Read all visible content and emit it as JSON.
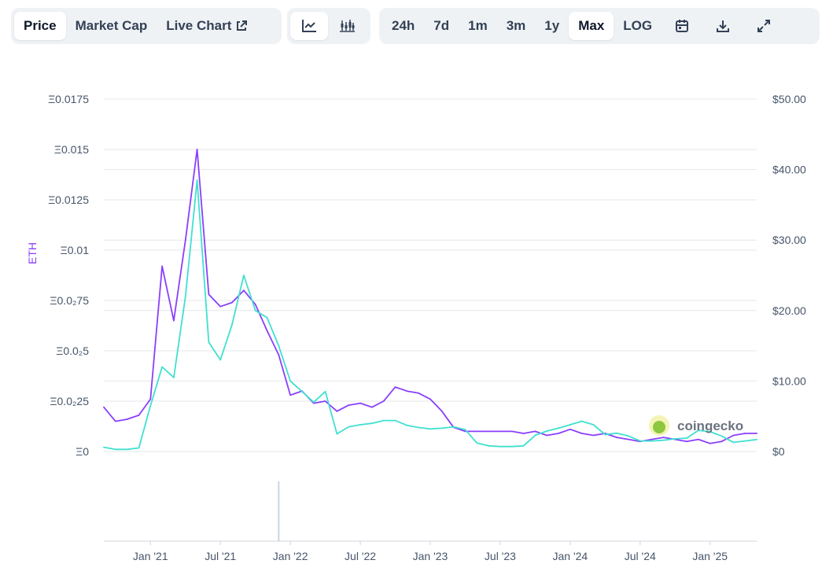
{
  "toolbar": {
    "metric_tabs": [
      "Price",
      "Market Cap",
      "Live Chart"
    ],
    "active_metric": "Price",
    "chart_type_icons": [
      "line-chart-icon",
      "candlestick-chart-icon"
    ],
    "ranges": [
      "24h",
      "7d",
      "1m",
      "3m",
      "1y",
      "Max",
      "LOG"
    ],
    "active_range": "Max",
    "action_icons": [
      "calendar-icon",
      "download-icon",
      "expand-icon"
    ]
  },
  "watermark": {
    "text": "coingecko"
  },
  "colors": {
    "eth_series": "#8a3ffc",
    "usd_series": "#40e0d0",
    "grid": "#e5e7eb",
    "axis_text": "#475569"
  },
  "chart_data": {
    "type": "line",
    "title": "",
    "y_left": {
      "label": "ETH",
      "ticks": [
        "Ξ0.0175",
        "Ξ0.015",
        "Ξ0.0125",
        "Ξ0.01",
        "Ξ0.0₂75",
        "Ξ0.0₂5",
        "Ξ0.0₂25",
        "Ξ0"
      ],
      "range": [
        0,
        0.0175
      ]
    },
    "y_right": {
      "ticks": [
        "$50.00",
        "$40.00",
        "$30.00",
        "$20.00",
        "$10.00",
        "$0"
      ],
      "range": [
        0,
        50
      ]
    },
    "x_ticks": [
      "Jan '21",
      "Jul '21",
      "Jan '22",
      "Jul '22",
      "Jan '23",
      "Jul '23",
      "Jan '24",
      "Jul '24",
      "Jan '25"
    ],
    "x_range": [
      "2020-09",
      "2025-05"
    ],
    "series": [
      {
        "axis": "left",
        "color": "#8a3ffc",
        "x": [
          "2020-09",
          "2020-10",
          "2020-11",
          "2020-12",
          "2021-01",
          "2021-02",
          "2021-03",
          "2021-04",
          "2021-05",
          "2021-06",
          "2021-07",
          "2021-08",
          "2021-09",
          "2021-10",
          "2021-11",
          "2021-12",
          "2022-01",
          "2022-02",
          "2022-03",
          "2022-04",
          "2022-05",
          "2022-06",
          "2022-07",
          "2022-08",
          "2022-09",
          "2022-10",
          "2022-11",
          "2022-12",
          "2023-01",
          "2023-02",
          "2023-03",
          "2023-04",
          "2023-05",
          "2023-06",
          "2023-07",
          "2023-08",
          "2023-09",
          "2023-10",
          "2023-11",
          "2023-12",
          "2024-01",
          "2024-02",
          "2024-03",
          "2024-04",
          "2024-05",
          "2024-06",
          "2024-07",
          "2024-08",
          "2024-09",
          "2024-10",
          "2024-11",
          "2024-12",
          "2025-01",
          "2025-02",
          "2025-03",
          "2025-04",
          "2025-05"
        ],
        "y": [
          0.0022,
          0.0015,
          0.0016,
          0.0018,
          0.0026,
          0.0092,
          0.0065,
          0.0105,
          0.015,
          0.0078,
          0.0072,
          0.0074,
          0.008,
          0.0073,
          0.006,
          0.0048,
          0.0028,
          0.003,
          0.0024,
          0.0025,
          0.002,
          0.0023,
          0.0024,
          0.0022,
          0.0025,
          0.0032,
          0.003,
          0.0029,
          0.0026,
          0.002,
          0.0012,
          0.001,
          0.001,
          0.001,
          0.001,
          0.001,
          0.0009,
          0.001,
          0.0008,
          0.0009,
          0.0011,
          0.0009,
          0.0008,
          0.0009,
          0.0007,
          0.0006,
          0.0005,
          0.0006,
          0.0007,
          0.0006,
          0.0005,
          0.0006,
          0.0004,
          0.0005,
          0.0008,
          0.0009,
          0.0009
        ]
      },
      {
        "axis": "right",
        "color": "#40e0d0",
        "x": [
          "2020-09",
          "2020-10",
          "2020-11",
          "2020-12",
          "2021-01",
          "2021-02",
          "2021-03",
          "2021-04",
          "2021-05",
          "2021-06",
          "2021-07",
          "2021-08",
          "2021-09",
          "2021-10",
          "2021-11",
          "2021-12",
          "2022-01",
          "2022-02",
          "2022-03",
          "2022-04",
          "2022-05",
          "2022-06",
          "2022-07",
          "2022-08",
          "2022-09",
          "2022-10",
          "2022-11",
          "2022-12",
          "2023-01",
          "2023-02",
          "2023-03",
          "2023-04",
          "2023-05",
          "2023-06",
          "2023-07",
          "2023-08",
          "2023-09",
          "2023-10",
          "2023-11",
          "2023-12",
          "2024-01",
          "2024-02",
          "2024-03",
          "2024-04",
          "2024-05",
          "2024-06",
          "2024-07",
          "2024-08",
          "2024-09",
          "2024-10",
          "2024-11",
          "2024-12",
          "2025-01",
          "2025-02",
          "2025-03",
          "2025-04",
          "2025-05"
        ],
        "y": [
          0.6,
          0.3,
          0.3,
          0.5,
          6.5,
          12.0,
          10.5,
          22.0,
          38.5,
          15.5,
          13.0,
          18.0,
          25.0,
          20.0,
          19.0,
          15.0,
          10.0,
          8.5,
          7.0,
          8.5,
          2.5,
          3.5,
          3.8,
          4.0,
          4.4,
          4.4,
          3.7,
          3.4,
          3.2,
          3.3,
          3.5,
          3.1,
          1.2,
          0.8,
          0.7,
          0.7,
          0.8,
          2.3,
          2.9,
          3.3,
          3.8,
          4.3,
          3.8,
          2.4,
          2.6,
          2.2,
          1.5,
          1.5,
          1.6,
          1.8,
          1.9,
          3.0,
          2.8,
          2.2,
          1.3,
          1.5,
          1.7
        ]
      }
    ],
    "volume": {
      "peak_month": "2021-12"
    },
    "grid": true,
    "legend": "none"
  }
}
